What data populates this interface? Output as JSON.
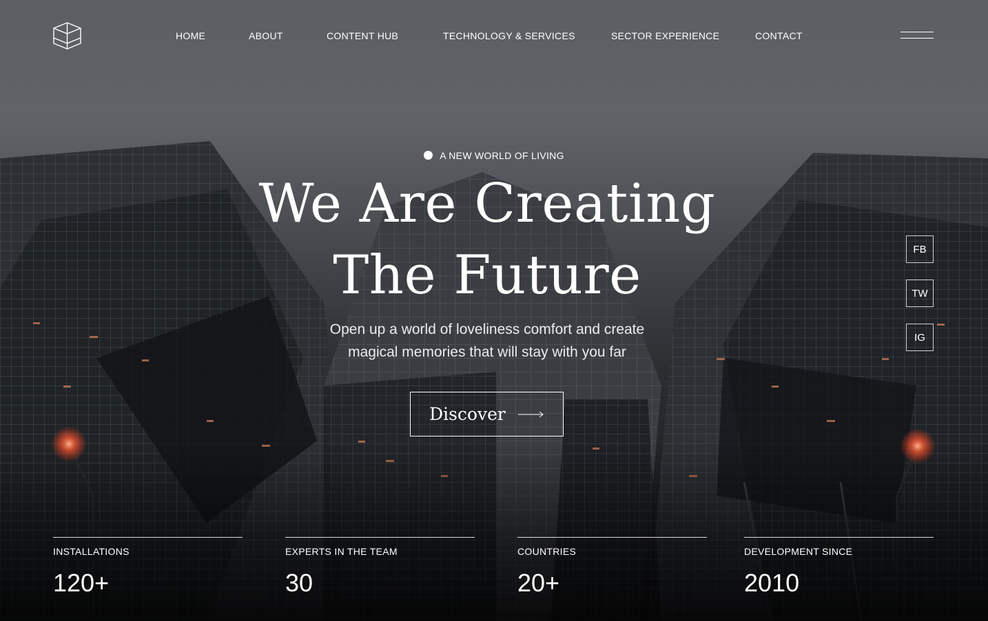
{
  "nav": {
    "items": [
      {
        "label": "HOME"
      },
      {
        "label": "ABOUT"
      },
      {
        "label": "CONTENT HUB"
      },
      {
        "label": "TECHNOLOGY & SERVICES"
      },
      {
        "label": "SECTOR EXPERIENCE"
      },
      {
        "label": "CONTACT"
      }
    ],
    "logo_icon": "cube-logo-icon",
    "menu_icon": "hamburger-menu-icon"
  },
  "hero": {
    "eyebrow": "A NEW WORLD OF LIVING",
    "headline": [
      "We Are Creating",
      "The Future"
    ],
    "subtitle": [
      "Open up a world of loveliness comfort and create",
      "magical memories that will stay with you far"
    ],
    "cta_label": "Discover",
    "cta_icon": "arrow-right-icon",
    "background": "dark city skyscrapers looking up"
  },
  "social": [
    {
      "label": "FB"
    },
    {
      "label": "TW"
    },
    {
      "label": "IG"
    }
  ],
  "stats": [
    {
      "label": "INSTALLATIONS",
      "value": "120+"
    },
    {
      "label": "EXPERTS IN THE TEAM",
      "value": "30"
    },
    {
      "label": "COUNTRIES",
      "value": "20+"
    },
    {
      "label": "DEVELOPMENT SINCE",
      "value": "2010"
    }
  ],
  "colors": {
    "text": "#ffffff",
    "background": "#1b1d21",
    "accent_light": "#ff7a50"
  }
}
